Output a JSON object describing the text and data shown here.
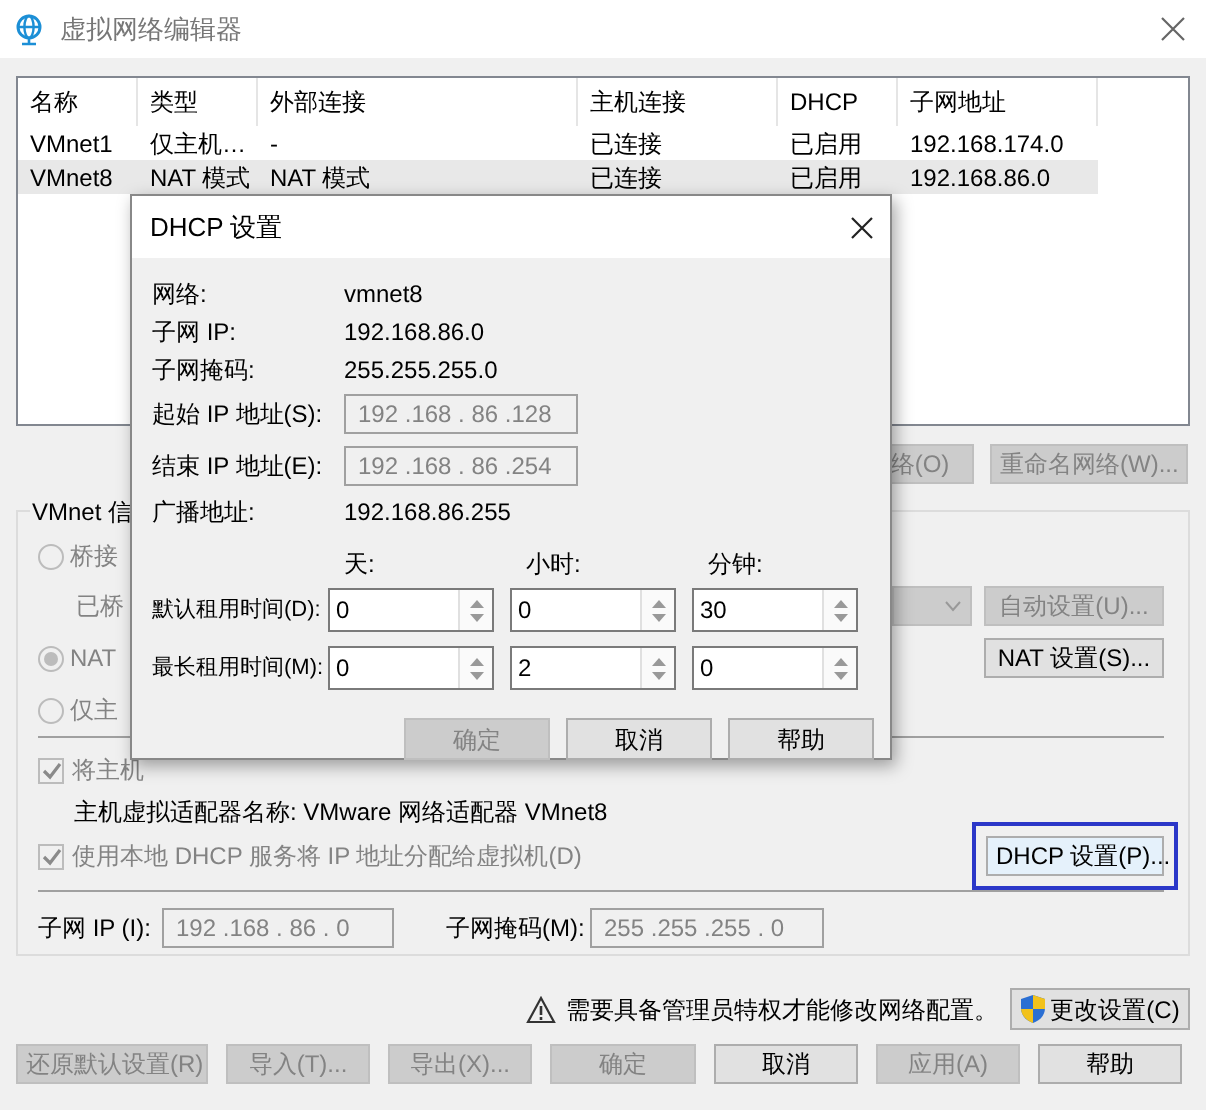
{
  "window": {
    "title": "虚拟网络编辑器"
  },
  "network_table": {
    "columns": [
      "名称",
      "类型",
      "外部连接",
      "主机连接",
      "DHCP",
      "子网地址"
    ],
    "rows": [
      {
        "cells": [
          "VMnet1",
          "仅主机…",
          "-",
          "已连接",
          "已启用",
          "192.168.174.0"
        ],
        "selected": false
      },
      {
        "cells": [
          "VMnet8",
          "NAT 模式",
          "NAT 模式",
          "已连接",
          "已启用",
          "192.168.86.0"
        ],
        "selected": true
      }
    ]
  },
  "table_buttons": [
    {
      "label": "络(O)",
      "disabled": true
    },
    {
      "label": "重命名网络(W)...",
      "disabled": true
    }
  ],
  "vmnet_info": {
    "title": "VMnet 信",
    "bridge_radio": {
      "label": "桥接",
      "selected": false,
      "disabled": true
    },
    "bridged_to_label": "已桥",
    "auto_settings_button": {
      "label": "自动设置(U)...",
      "disabled": true
    },
    "nat_radio": {
      "label": "NAT",
      "selected": true,
      "disabled": true
    },
    "nat_settings_button": {
      "label": "NAT 设置(S)...",
      "disabled": false
    },
    "host_only_radio": {
      "label": "仅主",
      "selected": false,
      "disabled": true
    },
    "connect_host_adapter": {
      "label": "将主机",
      "checked": true,
      "disabled": true
    },
    "adapter_name": "主机虚拟适配器名称: VMware 网络适配器 VMnet8",
    "use_local_dhcp": {
      "label": "使用本地 DHCP 服务将 IP 地址分配给虚拟机(D)",
      "checked": true,
      "disabled": true
    },
    "dhcp_settings_button": {
      "label": "DHCP 设置(P)...",
      "highlighted": true
    },
    "subnet_ip": {
      "label": "子网 IP (I):",
      "value": "192 .168 . 86 . 0"
    },
    "subnet_mask": {
      "label": "子网掩码(M):",
      "value": "255 .255 .255 . 0"
    }
  },
  "admin_notice": "需要具备管理员特权才能修改网络配置。",
  "change_settings_button": "更改设置(C)",
  "bottom_buttons": [
    {
      "label": "还原默认设置(R)",
      "disabled": true
    },
    {
      "label": "导入(T)...",
      "disabled": true
    },
    {
      "label": "导出(X)...",
      "disabled": true
    },
    {
      "label": "确定",
      "disabled": true
    },
    {
      "label": "取消",
      "disabled": false
    },
    {
      "label": "应用(A)",
      "disabled": true
    },
    {
      "label": "帮助",
      "disabled": false
    }
  ],
  "dhcp_dialog": {
    "title": "DHCP 设置",
    "info": [
      {
        "label": "网络:",
        "value": "vmnet8"
      },
      {
        "label": "子网 IP:",
        "value": "192.168.86.0"
      },
      {
        "label": "子网掩码:",
        "value": "255.255.255.0"
      }
    ],
    "ip_fields": [
      {
        "label": "起始 IP 地址(S):",
        "value": "192 .168 . 86 .128"
      },
      {
        "label": "结束 IP 地址(E):",
        "value": "192 .168 . 86 .254"
      }
    ],
    "broadcast": {
      "label": "广播地址:",
      "value": "192.168.86.255"
    },
    "lease_columns": [
      "天:",
      "小时:",
      "分钟:"
    ],
    "lease_rows": [
      {
        "label": "默认租用时间(D):",
        "values": [
          "0",
          "0",
          "30"
        ]
      },
      {
        "label": "最长租用时间(M):",
        "values": [
          "0",
          "2",
          "0"
        ]
      }
    ],
    "buttons": [
      {
        "label": "确定",
        "disabled": true
      },
      {
        "label": "取消",
        "disabled": false
      },
      {
        "label": "帮助",
        "disabled": false
      }
    ]
  }
}
